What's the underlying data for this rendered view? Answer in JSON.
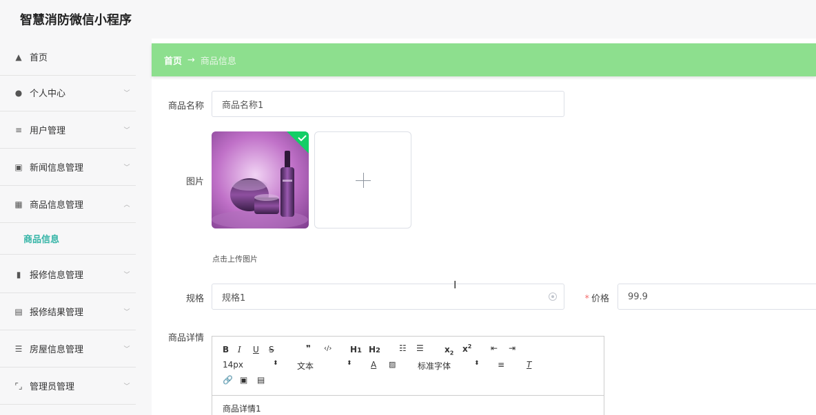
{
  "app": {
    "title": "智慧消防微信小程序"
  },
  "sidebar": {
    "items": [
      {
        "label": "首页",
        "icon": "home-icon"
      },
      {
        "label": "个人中心",
        "icon": "person-icon"
      },
      {
        "label": "用户管理",
        "icon": "list-icon"
      },
      {
        "label": "新闻信息管理",
        "icon": "chart-icon"
      },
      {
        "label": "商品信息管理",
        "icon": "grid-icon"
      },
      {
        "label": "报修信息管理",
        "icon": "bar-chart-icon"
      },
      {
        "label": "报修结果管理",
        "icon": "clipboard-icon"
      },
      {
        "label": "房屋信息管理",
        "icon": "lines-icon"
      },
      {
        "label": "管理员管理",
        "icon": "frame-icon"
      }
    ],
    "active_sub": "商品信息"
  },
  "breadcrumb": {
    "home": "首页",
    "separator": "→",
    "current": "商品信息"
  },
  "form": {
    "name_label": "商品名称",
    "name_value": "商品名称1",
    "image_label": "图片",
    "upload_hint": "点击上传图片",
    "spec_label": "规格",
    "spec_value": "规格1",
    "price_label": "价格",
    "price_value": "99.9",
    "detail_label": "商品详情"
  },
  "editor": {
    "font_size": "14px",
    "text_style": "文本",
    "font_family": "标准字体",
    "content": "商品详情1"
  },
  "colors": {
    "accent": "#33b4a6",
    "breadcrumb_bg": "#8ddf8e",
    "required": "#f56c6c"
  }
}
